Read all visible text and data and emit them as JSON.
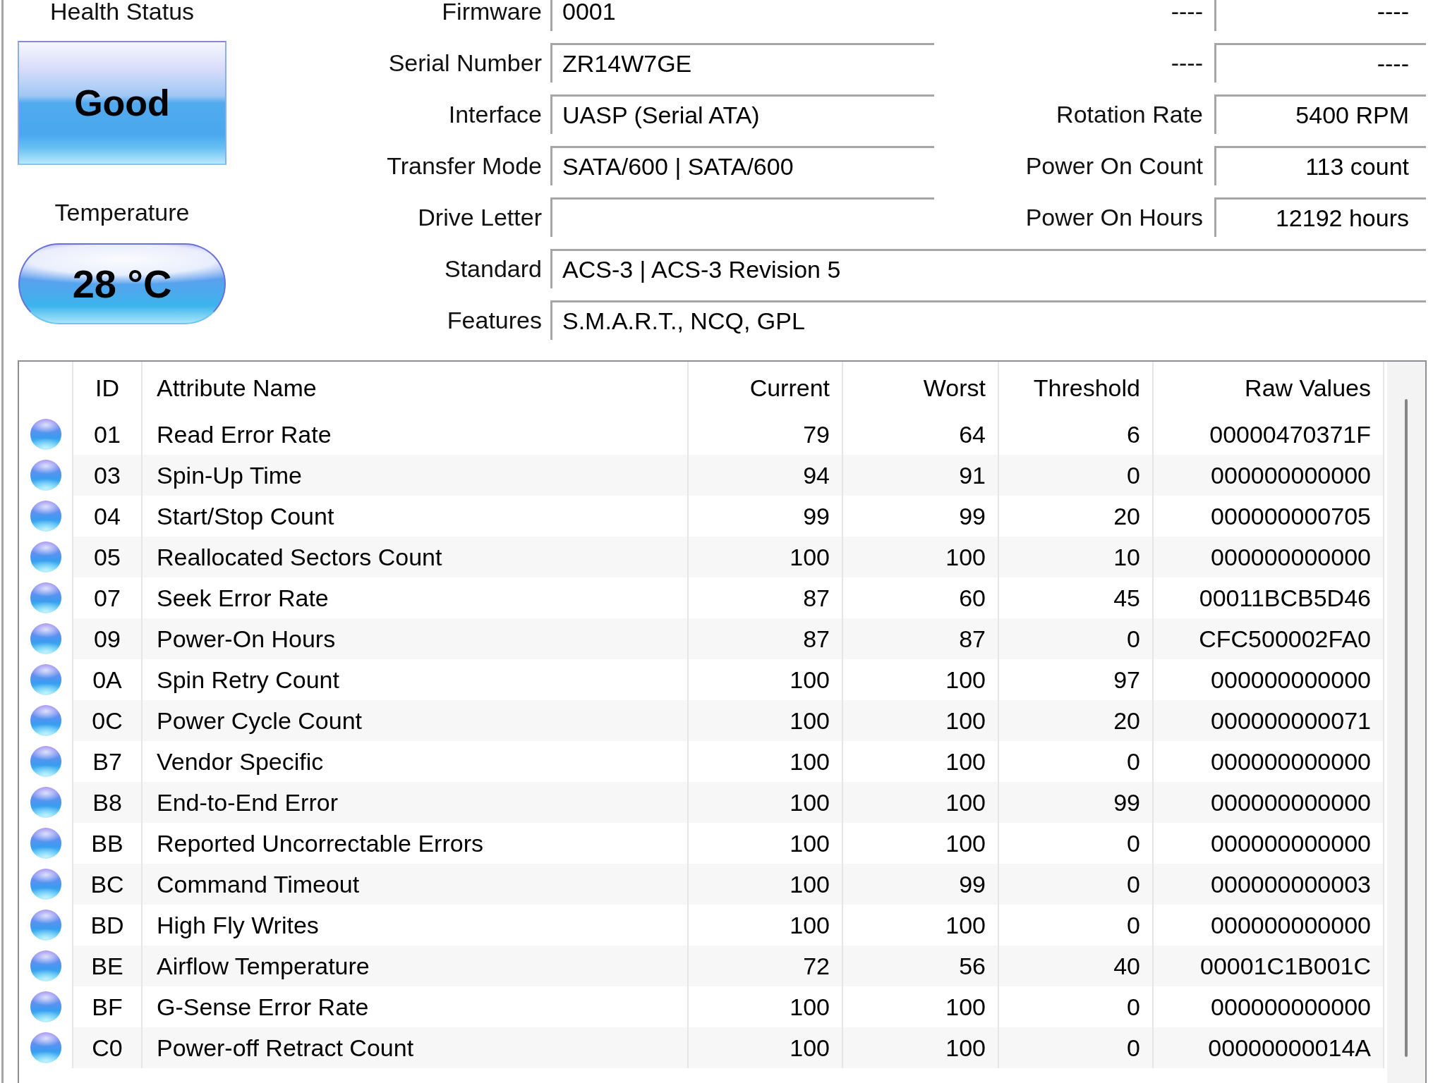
{
  "health_status": {
    "label": "Health Status",
    "value": "Good"
  },
  "temperature": {
    "label": "Temperature",
    "value": "28 °C"
  },
  "info_rows": [
    {
      "fields": [
        {
          "label": "Firmware",
          "value": "0001"
        },
        {
          "label": "----",
          "value": "----"
        }
      ]
    },
    {
      "fields": [
        {
          "label": "Serial Number",
          "value": "ZR14W7GE"
        },
        {
          "label": "----",
          "value": "----"
        }
      ]
    },
    {
      "fields": [
        {
          "label": "Interface",
          "value": "UASP (Serial ATA)"
        },
        {
          "label": "Rotation Rate",
          "value": "5400 RPM"
        }
      ]
    },
    {
      "fields": [
        {
          "label": "Transfer Mode",
          "value": "SATA/600 | SATA/600"
        },
        {
          "label": "Power On Count",
          "value": "113 count"
        }
      ]
    },
    {
      "fields": [
        {
          "label": "Drive Letter"
        },
        {
          "label": "Power On Hours",
          "value": "12192 hours"
        }
      ]
    },
    {
      "fields": [
        {
          "label": "Standard",
          "value": "ACS-3 | ACS-3 Revision 5"
        }
      ]
    },
    {
      "fields": [
        {
          "label": "Features",
          "value": "S.M.A.R.T., NCQ, GPL"
        }
      ]
    }
  ],
  "smart_table": {
    "columns": [
      "ID",
      "Attribute Name",
      "Current",
      "Worst",
      "Threshold",
      "Raw Values"
    ],
    "rows": [
      {
        "id": "01",
        "name": "Read Error Rate",
        "current": "79",
        "worst": "64",
        "threshold": "6",
        "raw": "00000470371F"
      },
      {
        "id": "03",
        "name": "Spin-Up Time",
        "current": "94",
        "worst": "91",
        "threshold": "0",
        "raw": "000000000000"
      },
      {
        "id": "04",
        "name": "Start/Stop Count",
        "current": "99",
        "worst": "99",
        "threshold": "20",
        "raw": "000000000705"
      },
      {
        "id": "05",
        "name": "Reallocated Sectors Count",
        "current": "100",
        "worst": "100",
        "threshold": "10",
        "raw": "000000000000"
      },
      {
        "id": "07",
        "name": "Seek Error Rate",
        "current": "87",
        "worst": "60",
        "threshold": "45",
        "raw": "00011BCB5D46"
      },
      {
        "id": "09",
        "name": "Power-On Hours",
        "current": "87",
        "worst": "87",
        "threshold": "0",
        "raw": "CFC500002FA0"
      },
      {
        "id": "0A",
        "name": "Spin Retry Count",
        "current": "100",
        "worst": "100",
        "threshold": "97",
        "raw": "000000000000"
      },
      {
        "id": "0C",
        "name": "Power Cycle Count",
        "current": "100",
        "worst": "100",
        "threshold": "20",
        "raw": "000000000071"
      },
      {
        "id": "B7",
        "name": "Vendor Specific",
        "current": "100",
        "worst": "100",
        "threshold": "0",
        "raw": "000000000000"
      },
      {
        "id": "B8",
        "name": "End-to-End Error",
        "current": "100",
        "worst": "100",
        "threshold": "99",
        "raw": "000000000000"
      },
      {
        "id": "BB",
        "name": "Reported Uncorrectable Errors",
        "current": "100",
        "worst": "100",
        "threshold": "0",
        "raw": "000000000000"
      },
      {
        "id": "BC",
        "name": "Command Timeout",
        "current": "100",
        "worst": "99",
        "threshold": "0",
        "raw": "000000000003"
      },
      {
        "id": "BD",
        "name": "High Fly Writes",
        "current": "100",
        "worst": "100",
        "threshold": "0",
        "raw": "000000000000"
      },
      {
        "id": "BE",
        "name": "Airflow Temperature",
        "current": "72",
        "worst": "56",
        "threshold": "40",
        "raw": "00001C1B001C"
      },
      {
        "id": "BF",
        "name": "G-Sense Error Rate",
        "current": "100",
        "worst": "100",
        "threshold": "0",
        "raw": "000000000000"
      },
      {
        "id": "C0",
        "name": "Power-off Retract Count",
        "current": "100",
        "worst": "100",
        "threshold": "0",
        "raw": "00000000014A"
      }
    ]
  }
}
